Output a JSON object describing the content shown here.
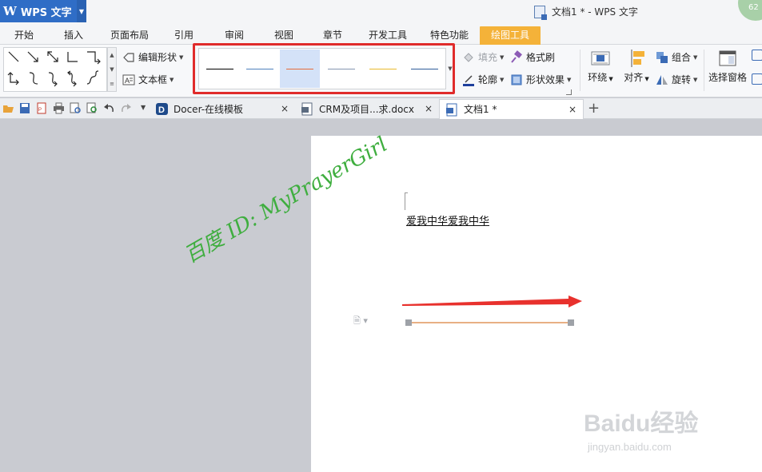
{
  "titlebar": {
    "app_button": "WPS 文字",
    "window_title": "文档1 * - WPS 文字",
    "corner_badge": "62"
  },
  "menu": {
    "tabs": [
      "开始",
      "插入",
      "页面布局",
      "引用",
      "审阅",
      "视图",
      "章节",
      "开发工具",
      "特色功能",
      "绘图工具"
    ],
    "active_tab": "绘图工具"
  },
  "ribbon": {
    "edit_shape": "编辑形状",
    "text_box": "文本框",
    "fill": "填充",
    "format_painter": "格式刷",
    "outline": "轮廓",
    "shape_effects": "形状效果",
    "wrap": "环绕",
    "align": "对齐",
    "group": "组合",
    "rotate": "旋转",
    "selection_pane": "选择窗格",
    "line_styles": [
      {
        "color": "#000000"
      },
      {
        "color": "#4f81bd"
      },
      {
        "color": "#e46c3a"
      },
      {
        "color": "#8496b0"
      },
      {
        "color": "#e8b92c"
      },
      {
        "color": "#2e5c99"
      }
    ],
    "selected_line_style": 2
  },
  "doc_tabs": [
    {
      "label": "Docer-在线模板",
      "close": "×"
    },
    {
      "label": "CRM及项目...求.docx",
      "close": "×"
    },
    {
      "label": "文档1 *",
      "close": "×"
    }
  ],
  "tab_add": "+",
  "document": {
    "body_text": "爱我中华爱我中华"
  },
  "watermarks": {
    "baidu_logo": "Baidu经验",
    "baidu_url": "jingyan.baidu.com",
    "author_id": "百度 ID: MyPrayerGirl"
  },
  "colors": {
    "accent_tab": "#f4b239",
    "app_blue": "#2f6dc6",
    "highlight_red": "#e02b2b",
    "arrow_red": "#e8312d",
    "line_orange": "#d9803a"
  }
}
